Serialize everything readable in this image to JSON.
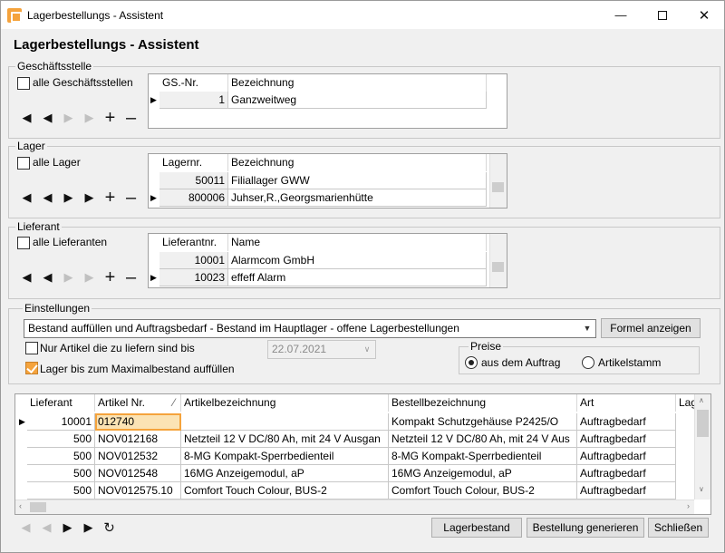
{
  "window": {
    "title": "Lagerbestellungs - Assistent",
    "minimize_icon": "minimize-icon",
    "maximize_icon": "maximize-icon",
    "close_icon": "close-icon",
    "app_icon": "app-icon"
  },
  "heading": "Lagerbestellungs - Assistent",
  "geschaeftsstelle": {
    "label": "Geschäftsstelle",
    "checkbox_label": "alle Geschäftsstellen",
    "columns": [
      "GS.-Nr.",
      "Bezeichnung"
    ],
    "rows": [
      {
        "nr": "1",
        "bezeichnung": "Ganzweitweg"
      }
    ]
  },
  "lager": {
    "label": "Lager",
    "checkbox_label": "alle Lager",
    "columns": [
      "Lagernr.",
      "Bezeichnung"
    ],
    "rows": [
      {
        "nr": "50011",
        "bezeichnung": "Filiallager GWW"
      },
      {
        "nr": "800006",
        "bezeichnung": "Juhser,R.,Georgsmarienhütte"
      }
    ]
  },
  "lieferant": {
    "label": "Lieferant",
    "checkbox_label": "alle Lieferanten",
    "columns": [
      "Lieferantnr.",
      "Name"
    ],
    "rows": [
      {
        "nr": "10001",
        "name": "Alarmcom GmbH"
      },
      {
        "nr": "10023",
        "name": "effeff Alarm"
      }
    ]
  },
  "einstellungen": {
    "label": "Einstellungen",
    "mode_value": "Bestand auffüllen und Auftragsbedarf - Bestand im Hauptlager - offene Lagerbestellungen",
    "formel_button": "Formel anzeigen",
    "nur_artikel_label": "Nur Artikel die zu liefern sind bis",
    "date_value": "22.07.2021",
    "maximalbestand_label": "Lager bis zum Maximalbestand auffüllen",
    "preise_label": "Preise",
    "radio_auftrag": "aus dem Auftrag",
    "radio_artikelstamm": "Artikelstamm"
  },
  "results": {
    "columns": [
      "Lieferant",
      "Artikel Nr.",
      "Artikelbezeichnung",
      "Bestellbezeichnung",
      "Art",
      "Lag"
    ],
    "rows": [
      {
        "lieferant": "10001",
        "artikel": "012740",
        "artikelbez": "",
        "bestellbez": "Kompakt Schutzgehäuse P2425/O",
        "art": "Auftragbedarf"
      },
      {
        "lieferant": "500",
        "artikel": "NOV012168",
        "artikelbez": "Netzteil 12 V DC/80 Ah, mit 24 V Ausgan",
        "bestellbez": "Netzteil 12 V DC/80 Ah, mit 24 V Aus",
        "art": "Auftragbedarf"
      },
      {
        "lieferant": "500",
        "artikel": "NOV012532",
        "artikelbez": "8-MG Kompakt-Sperrbedienteil",
        "bestellbez": "8-MG Kompakt-Sperrbedienteil",
        "art": "Auftragbedarf"
      },
      {
        "lieferant": "500",
        "artikel": "NOV012548",
        "artikelbez": "16MG Anzeigemodul, aP",
        "bestellbez": "16MG Anzeigemodul, aP",
        "art": "Auftragbedarf"
      },
      {
        "lieferant": "500",
        "artikel": "NOV012575.10",
        "artikelbez": "Comfort Touch Colour, BUS-2",
        "bestellbez": "Comfort Touch Colour, BUS-2",
        "art": "Auftragbedarf"
      }
    ]
  },
  "footer": {
    "lagerbestand_button": "Lagerbestand",
    "bestellung_button": "Bestellung generieren",
    "schliessen_button": "Schließen"
  }
}
